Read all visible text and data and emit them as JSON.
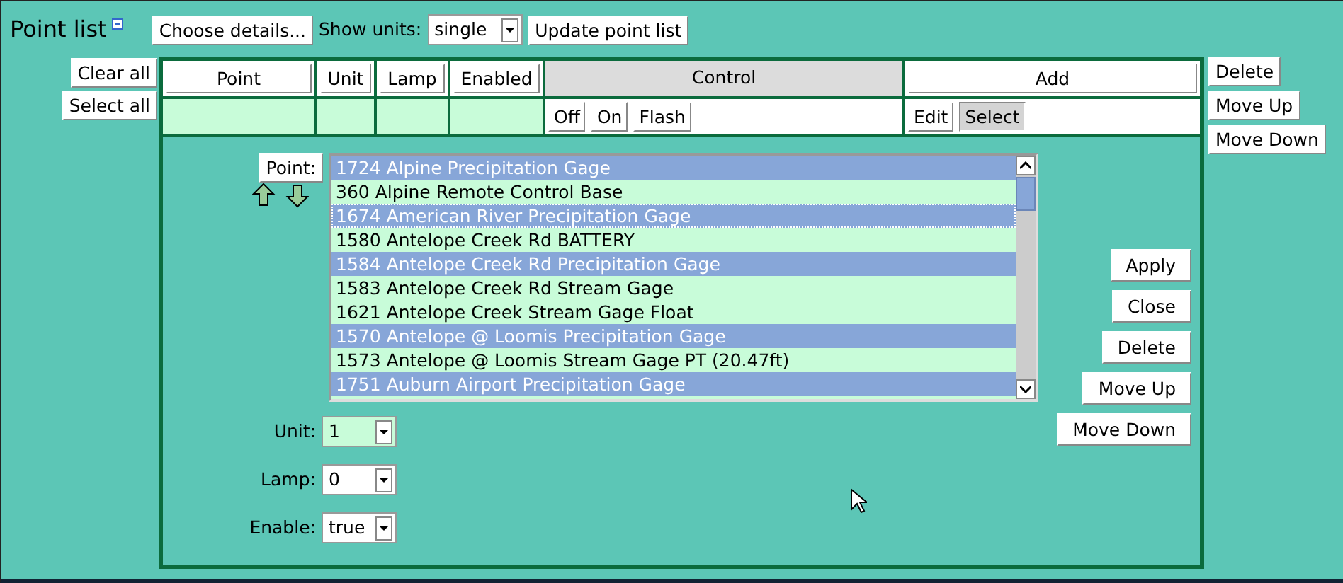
{
  "title": "Point list",
  "toolbar": {
    "choose_button": "Choose details...",
    "show_units_label": "Show units:",
    "show_units_value": "single",
    "update_button": "Update point list"
  },
  "left_buttons": [
    "Clear all",
    "Select all"
  ],
  "right_buttons": [
    "Delete",
    "Move Up",
    "Move Down"
  ],
  "columns": [
    {
      "label": "Point",
      "kind": "button"
    },
    {
      "label": "Unit",
      "kind": "button"
    },
    {
      "label": "Lamp",
      "kind": "button"
    },
    {
      "label": "Enabled",
      "kind": "button"
    },
    {
      "label": "Control",
      "kind": "header"
    },
    {
      "label": "Add",
      "kind": "button"
    }
  ],
  "filter_row": [
    {
      "kind": "empty"
    },
    {
      "kind": "empty"
    },
    {
      "kind": "empty"
    },
    {
      "kind": "empty"
    },
    {
      "kind": "buttons",
      "buttons": [
        {
          "label": "Off",
          "pressed": false
        },
        {
          "label": "On",
          "pressed": false
        },
        {
          "label": "Flash",
          "pressed": false
        }
      ]
    },
    {
      "kind": "buttons",
      "buttons": [
        {
          "label": "Edit",
          "pressed": false
        },
        {
          "label": "Select",
          "pressed": true
        }
      ]
    }
  ],
  "editor": {
    "point_button": "Point:",
    "points": [
      {
        "label": "1724 Alpine Precipitation Gage",
        "selected": true,
        "focused": false
      },
      {
        "label": "360 Alpine Remote Control Base",
        "selected": false,
        "focused": false
      },
      {
        "label": "1674 American River Precipitation Gage",
        "selected": true,
        "focused": true
      },
      {
        "label": "1580 Antelope Creek Rd BATTERY",
        "selected": false,
        "focused": false
      },
      {
        "label": "1584 Antelope Creek Rd Precipitation Gage",
        "selected": true,
        "focused": false
      },
      {
        "label": "1583 Antelope Creek Rd Stream Gage",
        "selected": false,
        "focused": false
      },
      {
        "label": "1621 Antelope Creek Stream Gage Float",
        "selected": false,
        "focused": false
      },
      {
        "label": "1570 Antelope @ Loomis Precipitation Gage",
        "selected": true,
        "focused": false
      },
      {
        "label": "1573 Antelope @ Loomis Stream Gage PT (20.47ft)",
        "selected": false,
        "focused": false
      },
      {
        "label": "1751 Auburn Airport Precipitation Gage",
        "selected": true,
        "focused": false
      }
    ],
    "fields": [
      {
        "label": "Unit:",
        "value": "1",
        "highlighted": true
      },
      {
        "label": "Lamp:",
        "value": "0",
        "highlighted": false
      },
      {
        "label": "Enable:",
        "value": "true",
        "highlighted": false
      }
    ],
    "buttons": [
      "Apply",
      "Close",
      "Delete",
      "Move Up",
      "Move Down"
    ]
  }
}
